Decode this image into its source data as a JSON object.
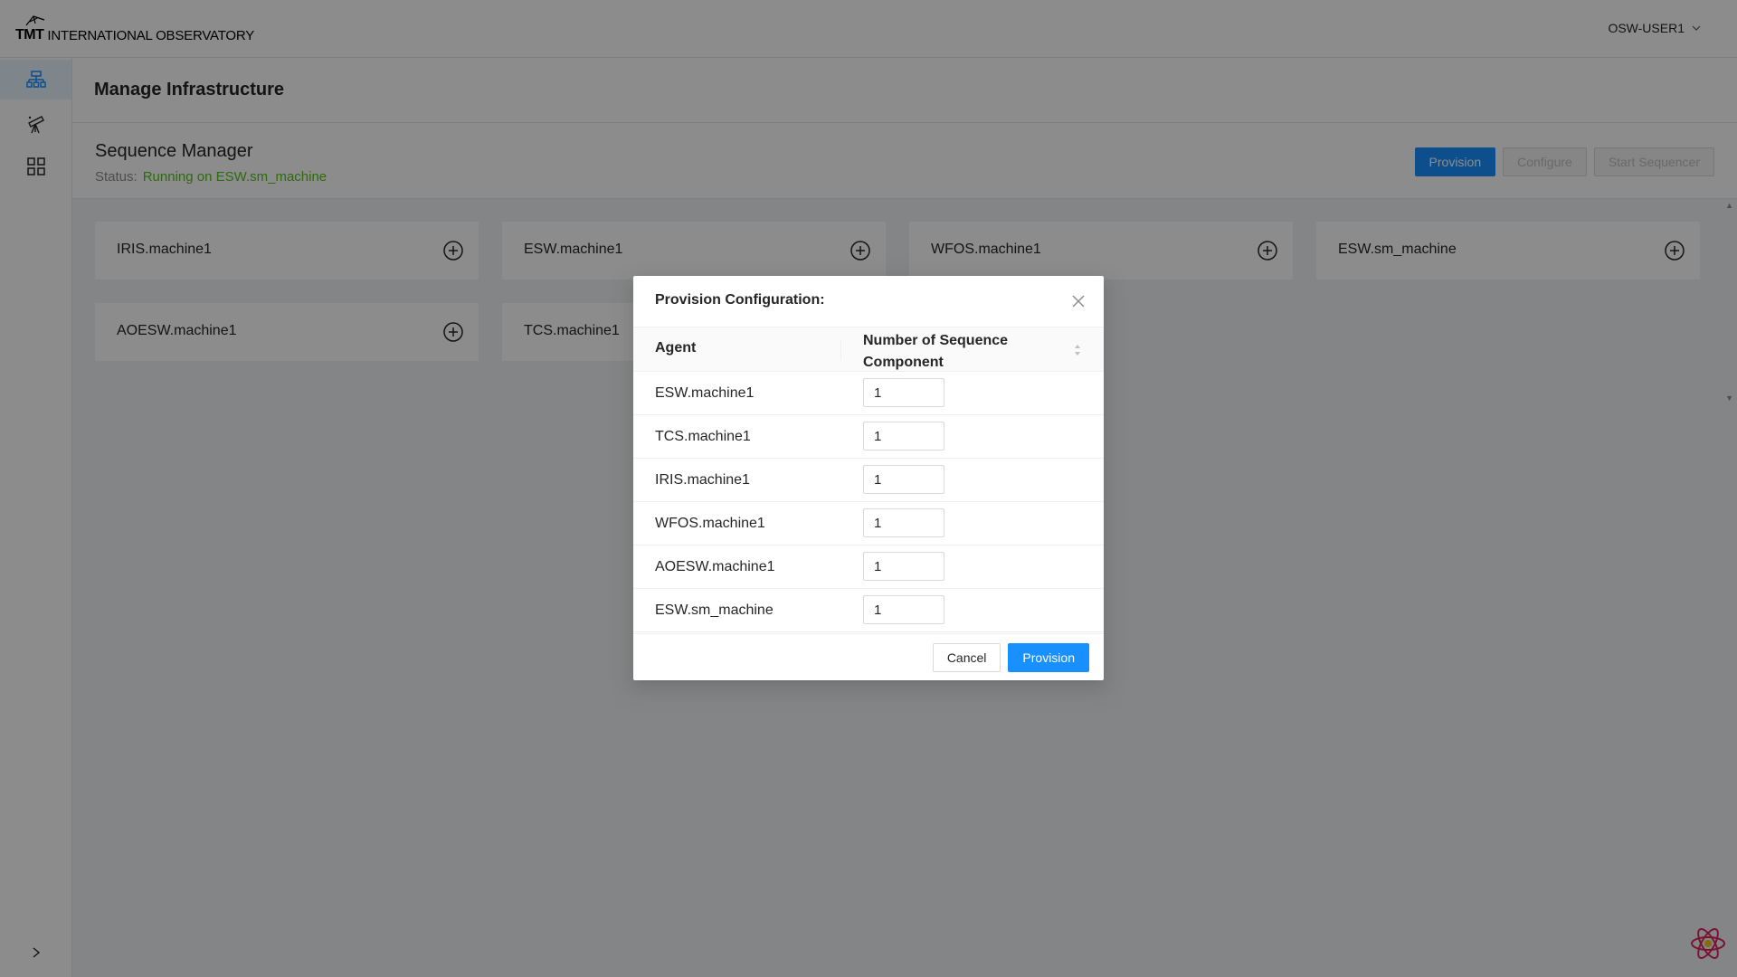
{
  "header": {
    "logo_mark": "TMT",
    "logo_text": "INTERNATIONAL OBSERVATORY",
    "user": "OSW-USER1"
  },
  "sidebar": {
    "items": [
      {
        "icon": "infrastructure-icon",
        "active": true
      },
      {
        "icon": "telescope-icon",
        "active": false
      },
      {
        "icon": "grid-icon",
        "active": false
      }
    ],
    "expand_icon": "chevron-right-icon"
  },
  "page": {
    "title": "Manage Infrastructure"
  },
  "sequence_manager": {
    "title": "Sequence Manager",
    "status_label": "Status:",
    "status_value": "Running on ESW.sm_machine",
    "buttons": {
      "provision": "Provision",
      "configure": "Configure",
      "start_sequencer": "Start Sequencer"
    }
  },
  "machines": [
    {
      "name": "IRIS.machine1"
    },
    {
      "name": "ESW.machine1"
    },
    {
      "name": "WFOS.machine1"
    },
    {
      "name": "ESW.sm_machine"
    },
    {
      "name": "AOESW.machine1"
    },
    {
      "name": "TCS.machine1"
    }
  ],
  "modal": {
    "title": "Provision Configuration:",
    "columns": {
      "agent": "Agent",
      "count": "Number of Sequence Component"
    },
    "rows": [
      {
        "agent": "ESW.machine1",
        "value": "1"
      },
      {
        "agent": "TCS.machine1",
        "value": "1"
      },
      {
        "agent": "IRIS.machine1",
        "value": "1"
      },
      {
        "agent": "WFOS.machine1",
        "value": "1"
      },
      {
        "agent": "AOESW.machine1",
        "value": "1"
      },
      {
        "agent": "ESW.sm_machine",
        "value": "1"
      }
    ],
    "cancel_label": "Cancel",
    "provision_label": "Provision"
  },
  "colors": {
    "primary": "#1890ff",
    "success": "#52c41a",
    "mask": "rgba(0,0,0,0.45)"
  }
}
